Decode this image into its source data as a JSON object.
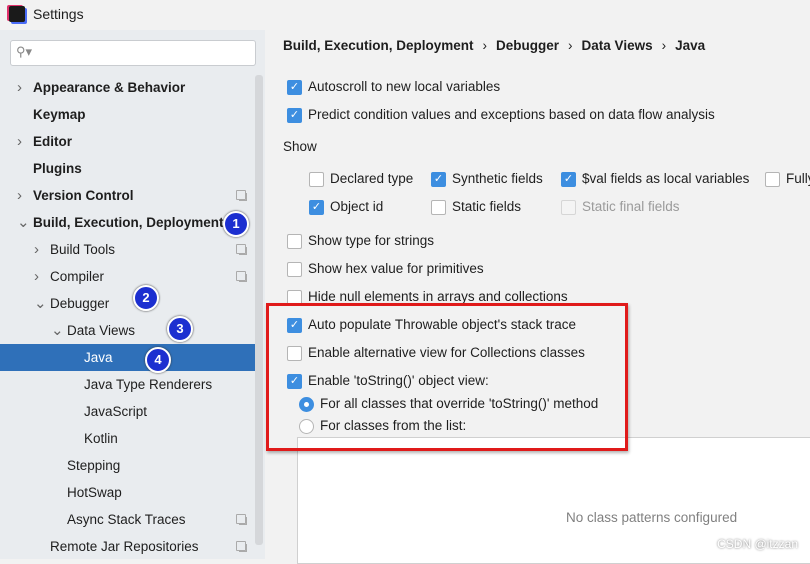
{
  "window": {
    "title": "Settings"
  },
  "search": {
    "placeholder": ""
  },
  "tree": [
    {
      "label": "Appearance & Behavior",
      "level": 0,
      "bold": true,
      "arrow": "›"
    },
    {
      "label": "Keymap",
      "level": 0,
      "bold": true
    },
    {
      "label": "Editor",
      "level": 0,
      "bold": true,
      "arrow": "›"
    },
    {
      "label": "Plugins",
      "level": 0,
      "bold": true
    },
    {
      "label": "Version Control",
      "level": 0,
      "bold": true,
      "arrow": "›",
      "copy": true
    },
    {
      "label": "Build, Execution, Deployment",
      "level": 0,
      "bold": true,
      "arrow": "⌄"
    },
    {
      "label": "Build Tools",
      "level": 1,
      "arrow": "›",
      "copy": true
    },
    {
      "label": "Compiler",
      "level": 1,
      "arrow": "›",
      "copy": true
    },
    {
      "label": "Debugger",
      "level": 1,
      "arrow": "⌄"
    },
    {
      "label": "Data Views",
      "level": 2,
      "arrow": "⌄"
    },
    {
      "label": "Java",
      "level": 3,
      "selected": true
    },
    {
      "label": "Java Type Renderers",
      "level": 3
    },
    {
      "label": "JavaScript",
      "level": 3
    },
    {
      "label": "Kotlin",
      "level": 3
    },
    {
      "label": "Stepping",
      "level": 2
    },
    {
      "label": "HotSwap",
      "level": 2
    },
    {
      "label": "Async Stack Traces",
      "level": 2,
      "copy": true
    },
    {
      "label": "Remote Jar Repositories",
      "level": 1,
      "copy": true
    }
  ],
  "badges": [
    "1",
    "2",
    "3",
    "4"
  ],
  "breadcrumb": [
    "Build, Execution, Deployment",
    "Debugger",
    "Data Views",
    "Java"
  ],
  "breadcrumb_sep": "›",
  "options": {
    "autoscroll": {
      "label": "Autoscroll to new local variables",
      "checked": true
    },
    "predict": {
      "label": "Predict condition values and exceptions based on data flow analysis",
      "checked": true
    },
    "show_heading": "Show",
    "declared_type": {
      "label": "Declared type",
      "checked": false
    },
    "synthetic": {
      "label": "Synthetic fields",
      "checked": true
    },
    "val_fields": {
      "label": "$val fields as local variables",
      "checked": true
    },
    "fully": {
      "label": "Fully",
      "checked": false
    },
    "object_id": {
      "label": "Object id",
      "checked": true
    },
    "static_fields": {
      "label": "Static fields",
      "checked": false
    },
    "static_final": {
      "label": "Static final fields",
      "checked": false,
      "disabled": true
    },
    "type_strings": {
      "label": "Show type for strings",
      "checked": false
    },
    "hex": {
      "label": "Show hex value for primitives",
      "checked": false
    },
    "hide_null": {
      "label": "Hide null elements in arrays and collections",
      "checked": false
    },
    "throwable": {
      "label": "Auto populate Throwable object's stack trace",
      "checked": true
    },
    "alt_view": {
      "label": "Enable alternative view for Collections classes",
      "checked": false
    },
    "tostring": {
      "label": "Enable 'toString()' object view:",
      "checked": true
    },
    "radio_all": {
      "label": "For all classes that override 'toString()' method",
      "selected": true
    },
    "radio_list": {
      "label": "For classes from the list:",
      "selected": false
    }
  },
  "list": {
    "empty_text": "No class patterns configured"
  },
  "watermark": "CSDN @itzzan",
  "colors": {
    "accent": "#3d8ee0",
    "selection": "#2f70b9",
    "highlight_box": "#e01a1a",
    "badge": "#1c2fd0"
  }
}
